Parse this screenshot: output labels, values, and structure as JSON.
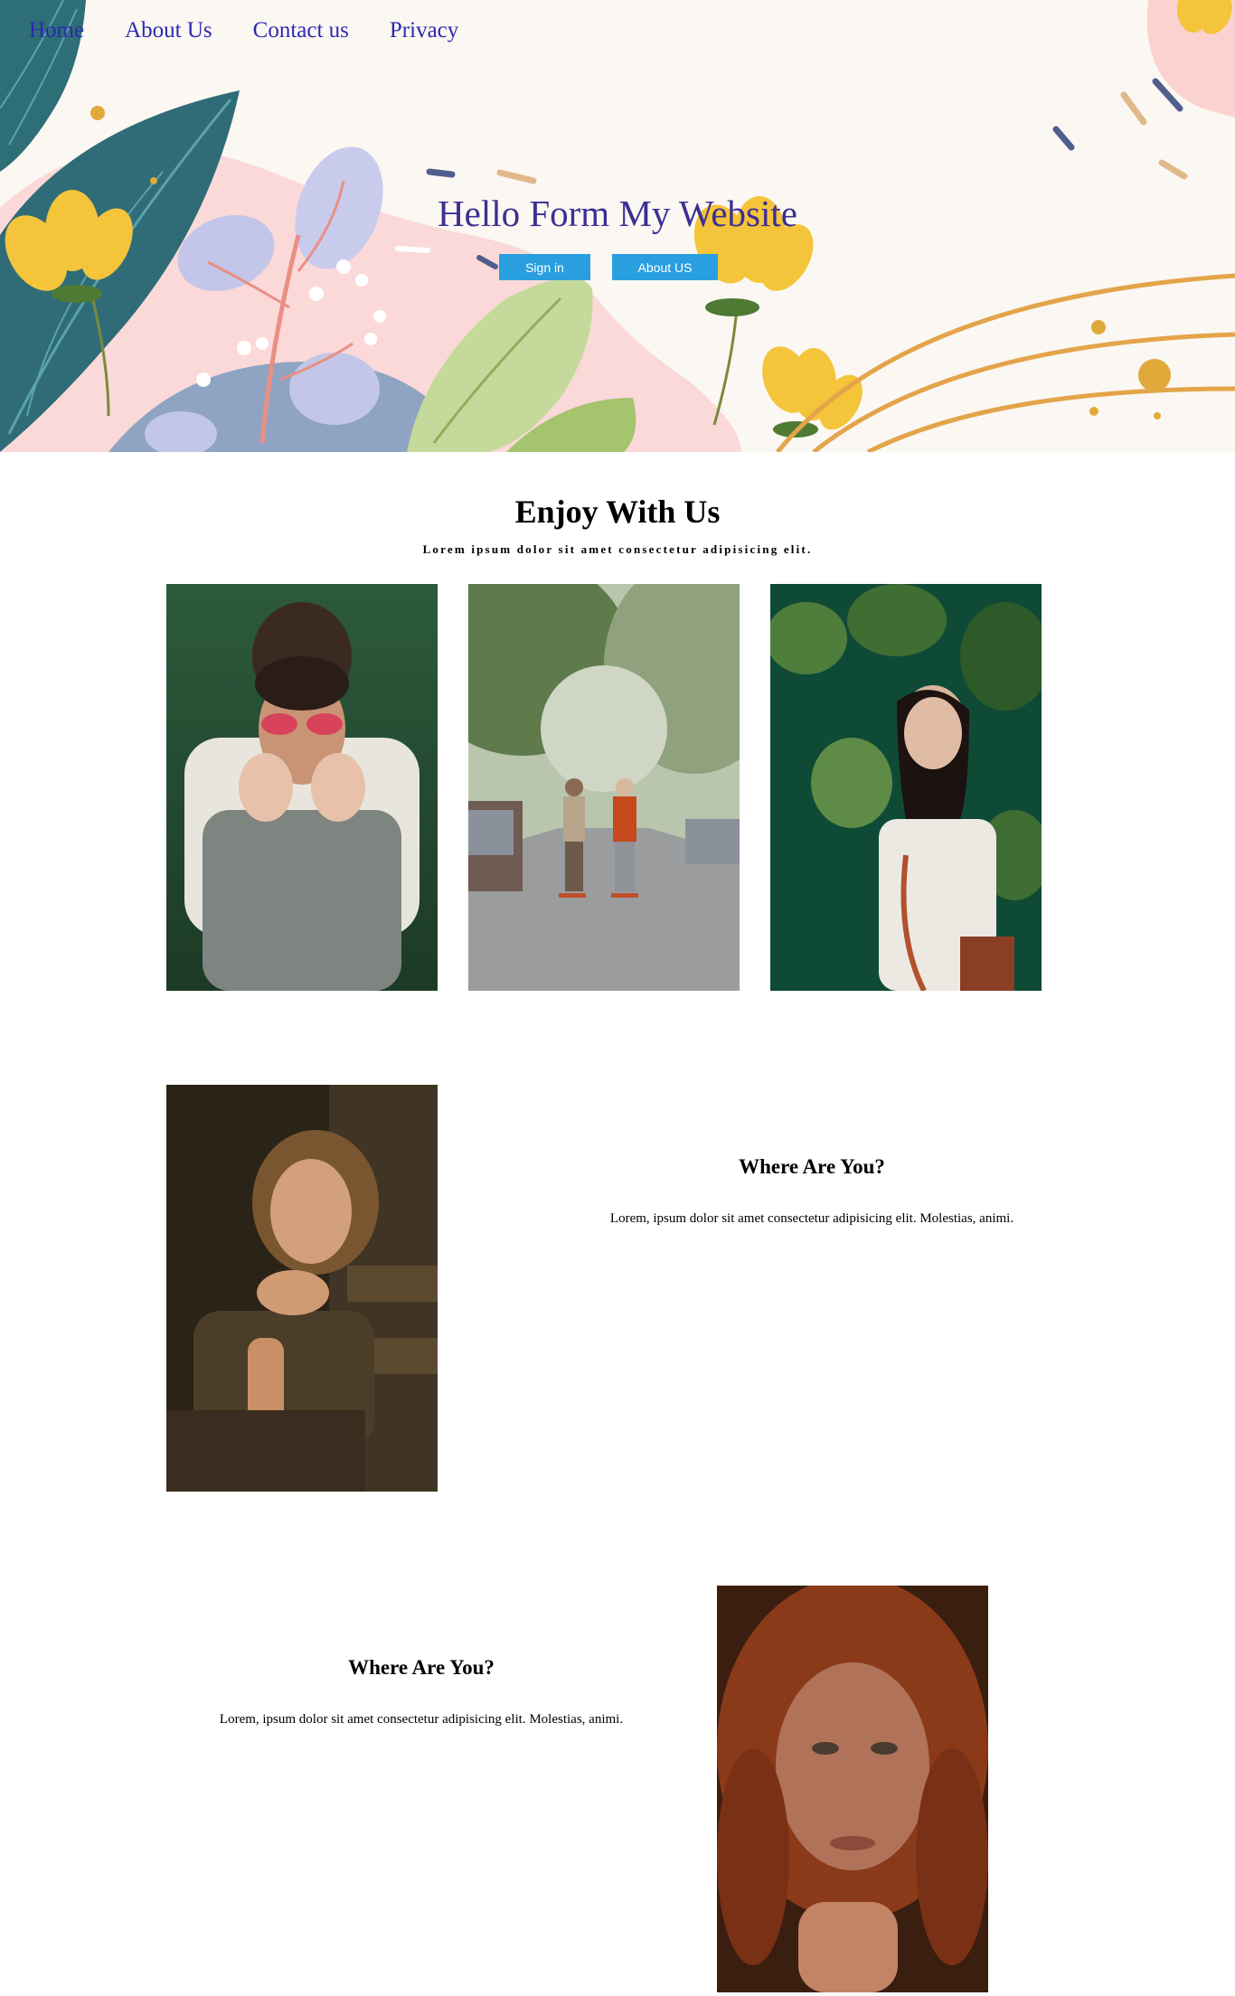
{
  "nav": {
    "items": [
      {
        "label": "Home"
      },
      {
        "label": "About Us"
      },
      {
        "label": "Contact us"
      },
      {
        "label": "Privacy"
      }
    ]
  },
  "hero": {
    "title": "Hello Form My Website",
    "signin_label": "Sign in",
    "about_label": "About US"
  },
  "enjoy": {
    "title": "Enjoy With Us",
    "subtitle": "Lorem ipsum dolor sit amet consectetur adipisicing elit."
  },
  "gallery": [
    {
      "name": "friends-covering-mouth-photo"
    },
    {
      "name": "skateboarding-couple-photo"
    },
    {
      "name": "woman-with-leaves-photo"
    }
  ],
  "feature1": {
    "title": "Where Are You?",
    "text": "Lorem, ipsum dolor sit amet consectetur adipisicing elit. Molestias, animi."
  },
  "feature2": {
    "title": "Where Are You?",
    "text": "Lorem, ipsum dolor sit amet consectetur adipisicing elit. Molestias, animi."
  },
  "colors": {
    "nav_link": "#2b2ab0",
    "hero_title": "#3d2f93",
    "button": "#2a9fe0",
    "hero_bg": "#fbf7f2"
  }
}
